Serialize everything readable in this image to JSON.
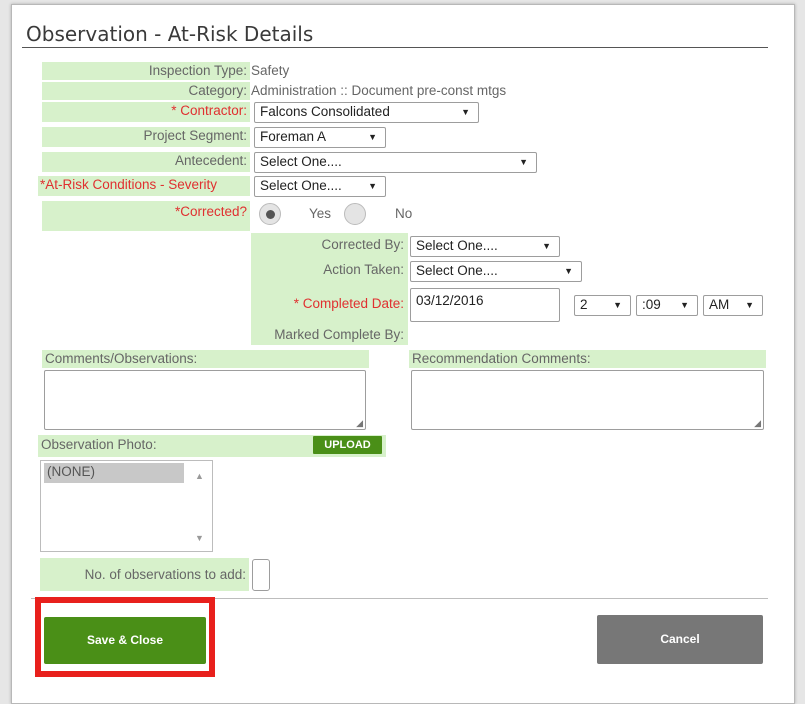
{
  "dialog": {
    "title": "Observation - At-Risk Details"
  },
  "fields": {
    "inspection_type": {
      "label": "Inspection Type:",
      "value": "Safety"
    },
    "category": {
      "label": "Category:",
      "value": "Administration :: Document pre-const mtgs"
    },
    "contractor": {
      "label": "* Contractor:",
      "value": "Falcons Consolidated"
    },
    "project_segment": {
      "label": "Project Segment:",
      "value": "Foreman A"
    },
    "antecedent": {
      "label": "Antecedent:",
      "value": "Select One...."
    },
    "severity": {
      "label": "*At-Risk Conditions - Severity",
      "value": "Select One...."
    },
    "corrected": {
      "label": "*Corrected?",
      "yes": "Yes",
      "no": "No",
      "selected": "Yes"
    },
    "corrected_by": {
      "label": "Corrected By:",
      "value": "Select One...."
    },
    "action_taken": {
      "label": "Action Taken:",
      "value": "Select One...."
    },
    "completed_date": {
      "label": "* Completed Date:",
      "value": "03/12/2016",
      "hour": "2",
      "minute": ":09",
      "ampm": "AM"
    },
    "marked_complete_by": {
      "label": "Marked Complete By:"
    },
    "comments": {
      "label": "Comments/Observations:",
      "value": ""
    },
    "recommendation": {
      "label": "Recommendation Comments:",
      "value": ""
    },
    "photo": {
      "label": "Observation Photo:",
      "upload_label": "UPLOAD",
      "items": [
        "(NONE)"
      ]
    },
    "num_observations": {
      "label": "No. of observations to add:",
      "value": ""
    }
  },
  "icons": {
    "dropdown": "▼",
    "scroll_up": "▲",
    "scroll_down": "▼",
    "resize": "◢"
  },
  "buttons": {
    "save_close": "Save & Close",
    "cancel": "Cancel"
  },
  "colors": {
    "label_bg": "#d7f1cb",
    "required_text": "#e03030",
    "primary_button": "#4a8f17",
    "cancel_button": "#777777",
    "highlight": "#e8201c"
  }
}
